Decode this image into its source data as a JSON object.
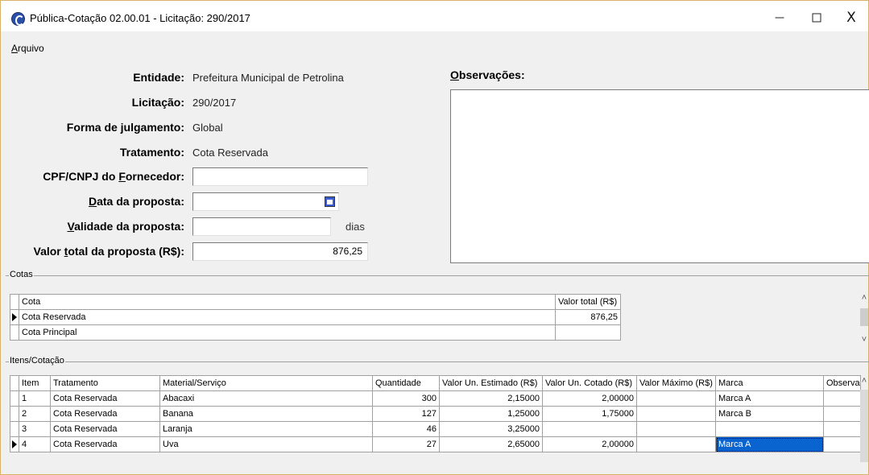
{
  "window": {
    "title": "Pública-Cotação 02.00.01 - Licitação: 290/2017",
    "minimize": "–",
    "maximize": "☐",
    "close": "X"
  },
  "menu": {
    "arquivo_first": "A",
    "arquivo_rest": "rquivo"
  },
  "form": {
    "entidade_label": "Entidade:",
    "entidade_value": "Prefeitura Municipal de Petrolina",
    "licitacao_label": "Licitação:",
    "licitacao_value": "290/2017",
    "julgamento_label": "Forma de julgamento:",
    "julgamento_value": "Global",
    "tratamento_label": "Tratamento:",
    "tratamento_value": "Cota Reservada",
    "cpf_label_pre": "CPF/CNPJ do ",
    "cpf_label_u": "F",
    "cpf_label_post": "ornecedor:",
    "cpf_value": "",
    "data_label_u": "D",
    "data_label_post": "ata da proposta:",
    "data_value": "",
    "validade_label_u": "V",
    "validade_label_post": "alidade da proposta:",
    "validade_value": "",
    "validade_unit": "dias",
    "valor_label_pre": "Valor ",
    "valor_label_u": "t",
    "valor_label_post": "otal da proposta (R$):",
    "valor_value": "876,25"
  },
  "observacoes": {
    "label_u": "O",
    "label_post": "bservações:",
    "text": ""
  },
  "cotas": {
    "group_title": "Cotas",
    "headers": [
      "Cota",
      "Valor total (R$)"
    ],
    "rows": [
      {
        "cota": "Cota Reservada",
        "valor": "876,25"
      },
      {
        "cota": "Cota Principal",
        "valor": ""
      }
    ]
  },
  "itens": {
    "group_title": "Itens/Cotação",
    "headers": [
      "Item",
      "Tratamento",
      "Material/Serviço",
      "Quantidade",
      "Valor Un. Estimado (R$)",
      "Valor Un. Cotado (R$)",
      "Valor Máximo (R$)",
      "Marca",
      "Observaç"
    ],
    "rows": [
      {
        "item": "1",
        "tratamento": "Cota Reservada",
        "material": "Abacaxi",
        "quantidade": "300",
        "estimado": "2,15000",
        "cotado": "2,00000",
        "maximo": "",
        "marca": "Marca A",
        "obs": ""
      },
      {
        "item": "2",
        "tratamento": "Cota Reservada",
        "material": "Banana",
        "quantidade": "127",
        "estimado": "1,25000",
        "cotado": "1,75000",
        "maximo": "",
        "marca": "Marca B",
        "obs": ""
      },
      {
        "item": "3",
        "tratamento": "Cota Reservada",
        "material": "Laranja",
        "quantidade": "46",
        "estimado": "3,25000",
        "cotado": "",
        "maximo": "",
        "marca": "",
        "obs": ""
      },
      {
        "item": "4",
        "tratamento": "Cota Reservada",
        "material": "Uva",
        "quantidade": "27",
        "estimado": "2,65000",
        "cotado": "2,00000",
        "maximo": "",
        "marca": "Marca A",
        "obs": ""
      }
    ]
  },
  "scroll": {
    "up": "˄",
    "down": "˅"
  },
  "icons": {
    "app": "app-logo-icon",
    "calendar": "calendar-icon",
    "row_indicator": "row-pointer-icon"
  },
  "colors": {
    "selection": "#0a64cf",
    "window_bg": "#f0f0f0"
  }
}
